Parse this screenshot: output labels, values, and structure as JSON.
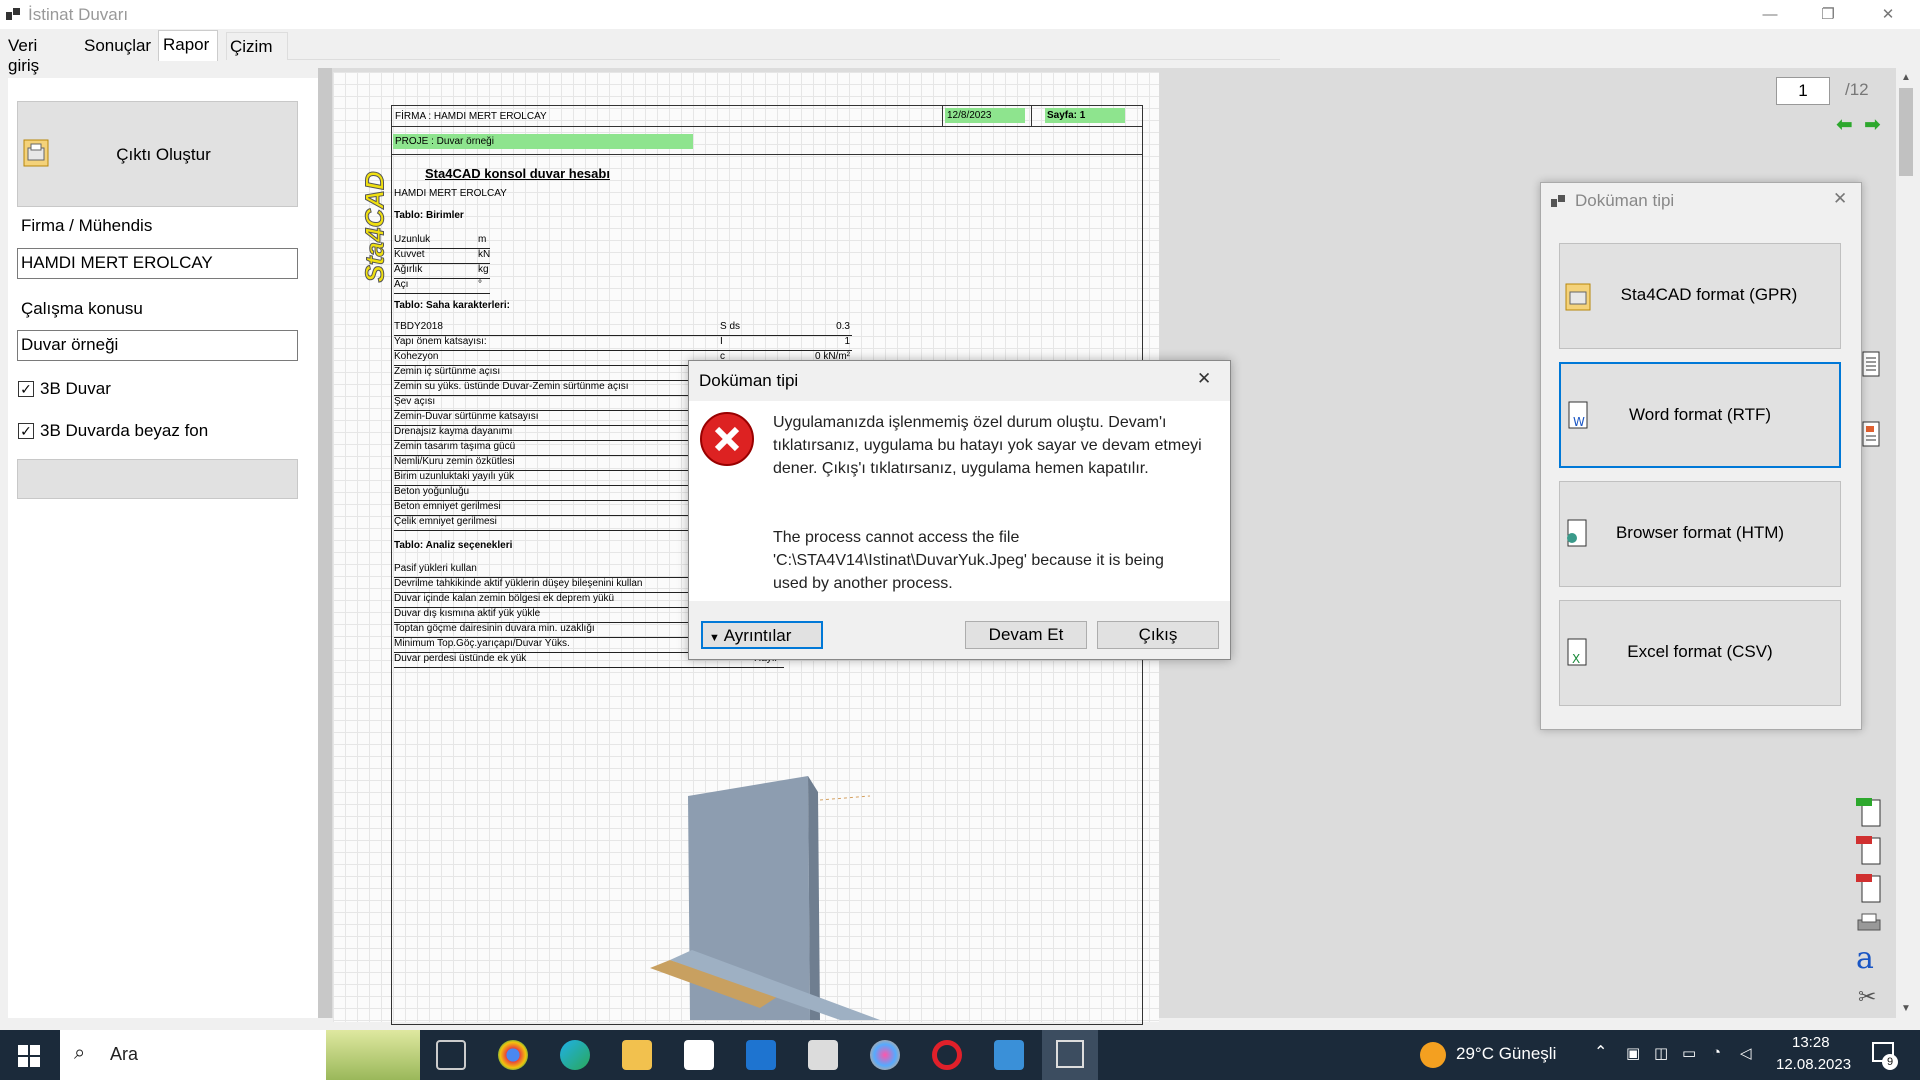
{
  "window": {
    "title": "İstinat Duvarı"
  },
  "tabs": [
    {
      "label": "Veri giriş"
    },
    {
      "label": "Sonuçlar"
    },
    {
      "label": "Rapor"
    },
    {
      "label": "Çizim"
    }
  ],
  "left": {
    "output_button": "Çıktı Oluştur",
    "firm_label": "Firma / Mühendis",
    "firm_value": "HAMDI MERT EROLCAY",
    "subject_label": "Çalışma konusu",
    "subject_value": "Duvar örneği",
    "check_3d_wall": "3B Duvar",
    "check_white_bg": "3B Duvarda beyaz fon"
  },
  "document": {
    "firm_line": "FİRMA : HAMDI MERT EROLCAY",
    "date": "12/8/2023",
    "page_label": "Sayfa: 1",
    "project_line": "PROJE : Duvar örneği",
    "logo_text": "Sta4CAD",
    "heading": "Sta4CAD konsol duvar hesabı",
    "author": "HAMDI MERT EROLCAY",
    "table_units_title": "Tablo: Birimler",
    "units": [
      {
        "name": "Uzunluk",
        "unit": "m"
      },
      {
        "name": "Kuvvet",
        "unit": "kN"
      },
      {
        "name": "Ağırlık",
        "unit": "kg"
      },
      {
        "name": "Açı",
        "unit": "°"
      }
    ],
    "table_site_title": "Tablo: Saha karakterleri:",
    "site_rows": [
      {
        "name": "TBDY2018",
        "sym": "S ds",
        "val": "0.3"
      },
      {
        "name": "Yapı önem katsayısı:",
        "sym": "I",
        "val": "1"
      },
      {
        "name": "Kohezyon",
        "sym": "c",
        "val": "0 kN/m²"
      },
      {
        "name": "Zemin iç sürtünme açısı",
        "sym": "",
        "val": ""
      },
      {
        "name": "Zemin su yüks. üstünde Duvar-Zemin sürtünme açısı",
        "sym": "",
        "val": ""
      },
      {
        "name": "Şev açısı",
        "sym": "",
        "val": ""
      },
      {
        "name": "Zemin-Duvar sürtünme katsayısı",
        "sym": "",
        "val": ""
      },
      {
        "name": "Drenajsız kayma dayanımı",
        "sym": "",
        "val": ""
      },
      {
        "name": "Zemin tasarım taşıma gücü",
        "sym": "",
        "val": ""
      },
      {
        "name": "Nemli/Kuru zemin özkütlesi",
        "sym": "",
        "val": ""
      },
      {
        "name": "Birim uzunluktaki yayılı yük",
        "sym": "",
        "val": ""
      },
      {
        "name": "Beton yoğunluğu",
        "sym": "",
        "val": ""
      },
      {
        "name": "Beton emniyet gerilmesi",
        "sym": "",
        "val": ""
      },
      {
        "name": "Çelik emniyet gerilmesi",
        "sym": "",
        "val": ""
      }
    ],
    "table_analysis_title": "Tablo: Analiz seçenekleri",
    "analysis_rows": [
      {
        "name": "Pasif yükleri kullan"
      },
      {
        "name": "Devrilme tahkikinde aktif yüklerin düşey bileşenini kullan"
      },
      {
        "name": "Duvar içinde kalan zemin bölgesi ek deprem yükü"
      },
      {
        "name": "Duvar dış kısmına aktif yük yükle"
      },
      {
        "name": "Toptan göçme dairesinin duvara min. uzaklığı"
      },
      {
        "name": "Minimum Top.Göç.yarıçapı/Duvar Yüks."
      },
      {
        "name": "Duvar perdesi üstünde ek yük",
        "val": "Hayır"
      }
    ]
  },
  "pager": {
    "current": "1",
    "total": "/12"
  },
  "doc_type_dialog": {
    "title": "Doküman tipi",
    "options": [
      {
        "label": "Sta4CAD format (GPR)"
      },
      {
        "label": "Word format (RTF)"
      },
      {
        "label": "Browser format (HTM)"
      },
      {
        "label": "Excel format (CSV)"
      }
    ]
  },
  "error_dialog": {
    "title": "Doküman tipi",
    "message_1": "Uygulamanızda işlenmemiş özel durum oluştu. Devam'ı tıklatırsanız, uygulama bu hatayı yok sayar ve devam etmeyi dener. Çıkış'ı tıklatırsanız, uygulama hemen kapatılır.",
    "message_2": "The process cannot access the file 'C:\\STA4V14\\Istinat\\DuvarYuk.Jpeg' because it is being used by another process.",
    "details_button": "Ayrıntılar",
    "continue_button": "Devam Et",
    "exit_button": "Çıkış"
  },
  "taskbar": {
    "search_placeholder": "Ara",
    "weather": "29°C Güneşli",
    "time": "13:28",
    "date": "12.08.2023",
    "notifications": "9"
  }
}
